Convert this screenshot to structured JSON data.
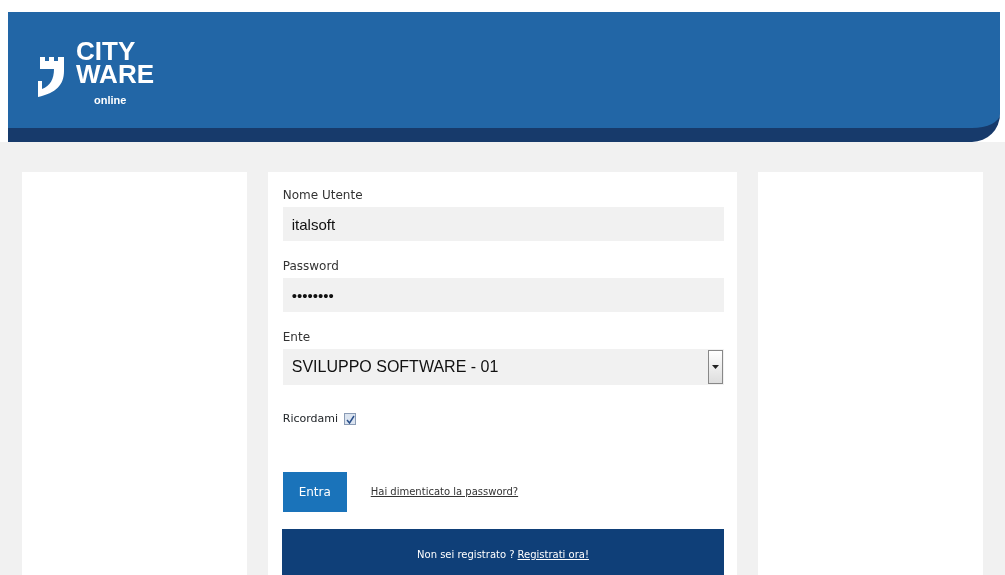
{
  "header": {
    "logo": [
      "CITY",
      "WARE",
      "online"
    ]
  },
  "form": {
    "fields": [
      {
        "kind": "text",
        "label": "Nome Utente",
        "value": "italsoft"
      },
      {
        "kind": "text",
        "label": "Password",
        "value": "••••••••"
      },
      {
        "kind": "select",
        "label": "Ente",
        "value": "SVILUPPO SOFTWARE - 01"
      }
    ],
    "remember": {
      "label": "Ricordami",
      "checked": true
    },
    "submit": "Entra",
    "forgot_link": "Hai dimenticato la password?",
    "register": {
      "text": "Non sei registrato ?",
      "link": "Registrati ora!"
    }
  }
}
